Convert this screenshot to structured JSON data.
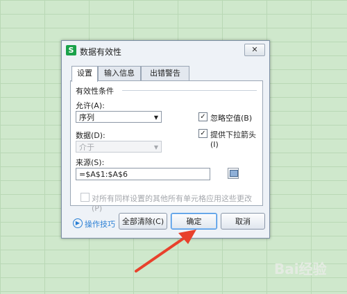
{
  "dialog": {
    "title": "数据有效性",
    "app_icon_letter": "S",
    "close_icon": "close-icon",
    "tabs": [
      {
        "label": "设置",
        "active": true
      },
      {
        "label": "输入信息",
        "active": false
      },
      {
        "label": "出错警告",
        "active": false
      }
    ],
    "group_title": "有效性条件",
    "allow": {
      "label": "允许(A):",
      "value": "序列"
    },
    "data": {
      "label": "数据(D):",
      "value": "介于",
      "disabled": true
    },
    "ignore_blank": {
      "label": "忽略空值(B)",
      "checked": true
    },
    "in_cell_dropdown": {
      "label": "提供下拉箭头(I)",
      "checked": true
    },
    "source": {
      "label": "来源(S):",
      "value": "=$A$1:$A$6"
    },
    "apply_all": {
      "label": "对所有同样设置的其他所有单元格应用这些更改(P)",
      "checked": false,
      "disabled": true
    },
    "tips_label": "操作技巧",
    "buttons": {
      "clear_all": "全部清除(C)",
      "ok": "确定",
      "cancel": "取消"
    }
  },
  "colors": {
    "sheet_background": "#cfe8cc",
    "annotation_arrow": "#e8412c",
    "tips_link": "#2a7fd4"
  }
}
